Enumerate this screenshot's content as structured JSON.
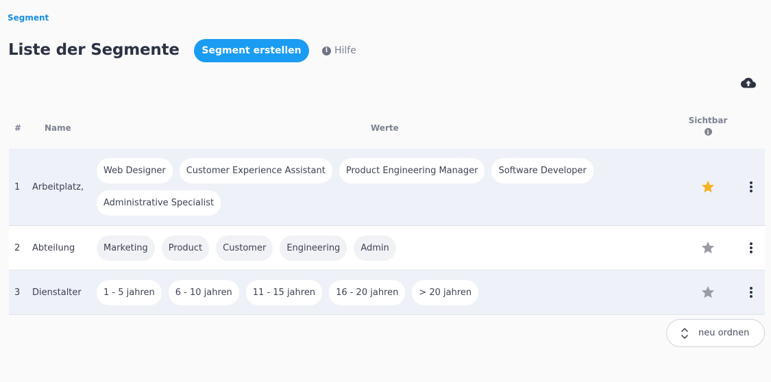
{
  "breadcrumb": "Segment",
  "page_title": "Liste der Segmente",
  "create_button_label": "Segment erstellen",
  "help_label": "Hilfe",
  "table": {
    "headers": {
      "number": "#",
      "name": "Name",
      "values": "Werte",
      "visible": "Sichtbar"
    },
    "rows": [
      {
        "number": "1",
        "name": "Arbeitplatz,",
        "values": [
          "Web Designer",
          "Customer Experience Assistant",
          "Product Engineering Manager",
          "Software Developer",
          "Administrative Specialist"
        ],
        "visible": true
      },
      {
        "number": "2",
        "name": "Abteilung",
        "values": [
          "Marketing",
          "Product",
          "Customer",
          "Engineering",
          "Admin"
        ],
        "visible": false
      },
      {
        "number": "3",
        "name": "Dienstalter",
        "values": [
          "1 - 5 jahren",
          "6 - 10 jahren",
          "11 - 15 jahren",
          "16 - 20 jahren",
          "> 20 jahren"
        ],
        "visible": false
      }
    ]
  },
  "reorder_button_label": "neu ordnen",
  "colors": {
    "accent": "#1a9cf2",
    "star_active": "#f5b323",
    "star_inactive": "#9a9ca3"
  },
  "icons": {
    "help": "info-icon",
    "upload": "cloud-upload-icon",
    "visible": "star-icon",
    "row_menu": "more-vertical-icon",
    "reorder": "chevron-up-down-icon"
  }
}
